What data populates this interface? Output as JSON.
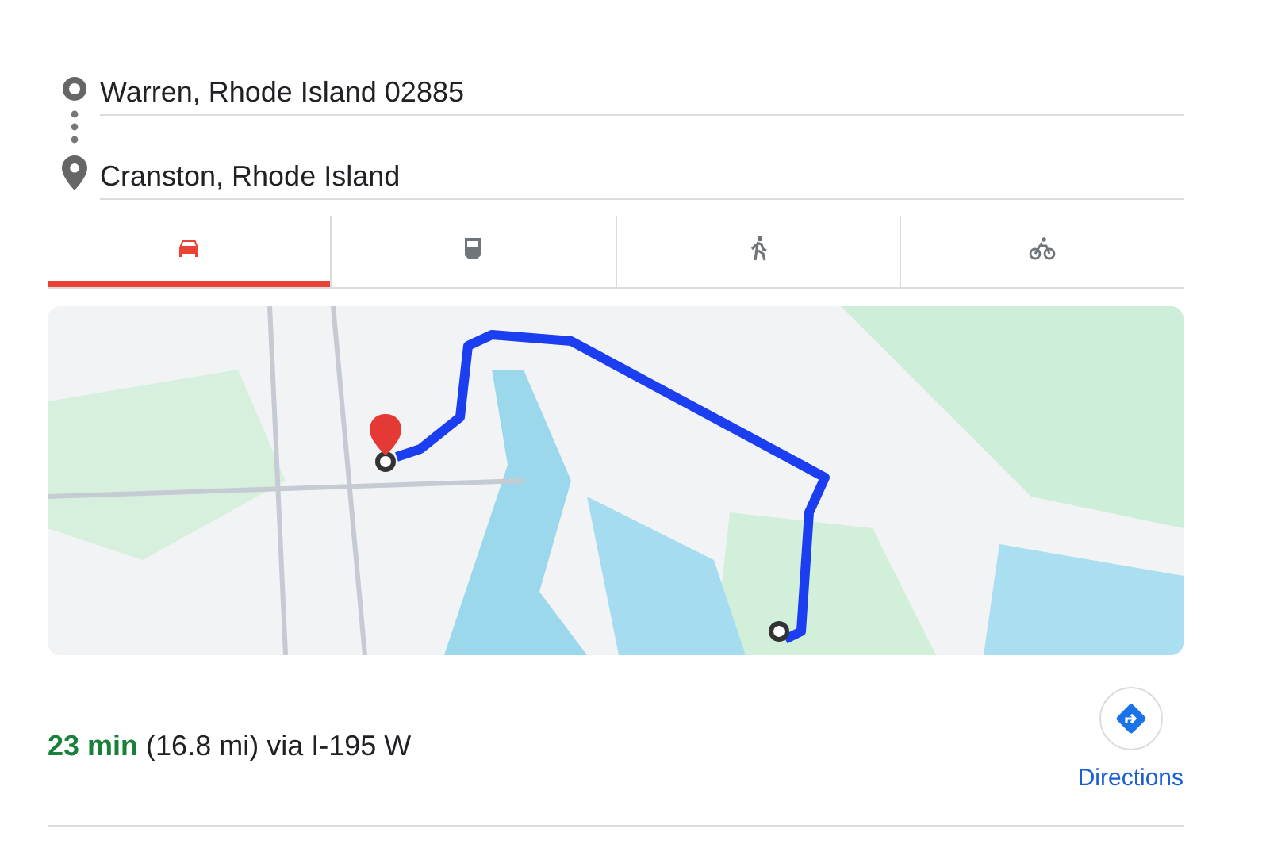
{
  "origin": {
    "value": "Warren, Rhode Island 02885"
  },
  "destination": {
    "value": "Cranston, Rhode Island"
  },
  "tabs": [
    {
      "kind": "car",
      "selected": true
    },
    {
      "kind": "transit",
      "selected": false
    },
    {
      "kind": "walk",
      "selected": false
    },
    {
      "kind": "bike",
      "selected": false
    }
  ],
  "route": {
    "duration": "23 min",
    "details": "(16.8 mi) via I-195 W"
  },
  "directions_button": {
    "label": "Directions"
  }
}
